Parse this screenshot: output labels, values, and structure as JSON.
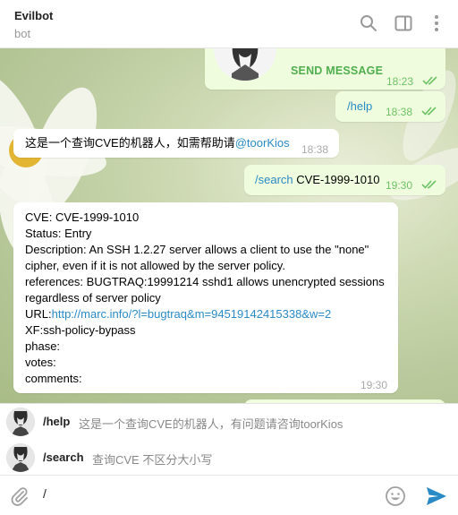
{
  "header": {
    "title": "Evilbot",
    "subtitle": "bot",
    "icons": [
      "search-icon",
      "sidebar-toggle-icon",
      "more-vertical-icon"
    ]
  },
  "messages": {
    "send_message": {
      "label": "SEND MESSAGE",
      "time": "18:23"
    },
    "help_cmd": {
      "text": "/help",
      "time": "18:38"
    },
    "intro": {
      "text": "这是一个查询CVE的机器人，如需帮助请",
      "mention": "@toorKios",
      "time": "18:38"
    },
    "search_cmd": {
      "command": "/search",
      "arg": "CVE-1999-1010",
      "time": "19:30"
    },
    "result": {
      "line1": "CVE: CVE-1999-1010",
      "line2": "Status: Entry",
      "line3": "Description: An SSH 1.2.27 server allows a client to use the \"none\"",
      "line4": "cipher, even if it is not allowed by the server policy.",
      "line5": "references: BUGTRAQ:19991214 sshd1 allows unencrypted sessions",
      "line6": "regardless of server policy",
      "url_label": "URL:",
      "url": "http://marc.info/?l=bugtraq&m=94519142415338&w=2",
      "line8": "XF:ssh-policy-bypass",
      "line9": "phase:",
      "line10": "votes:",
      "line11": "comments:",
      "time": "19:30"
    }
  },
  "suggestions": [
    {
      "command": "/help",
      "description": "这是一个查询CVE的机器人，有问题请咨询toorKios"
    },
    {
      "command": "/search",
      "description": "查询CVE  不区分大小写"
    }
  ],
  "composer": {
    "value": "/",
    "icons": [
      "attach-icon",
      "emoji-icon",
      "send-icon"
    ]
  },
  "colors": {
    "outgoing_bubble": "#effdde",
    "incoming_bubble": "#ffffff",
    "accent": "#2a8ac5",
    "outgoing_time": "#6cc264",
    "send_message_text": "#4fae4e"
  }
}
